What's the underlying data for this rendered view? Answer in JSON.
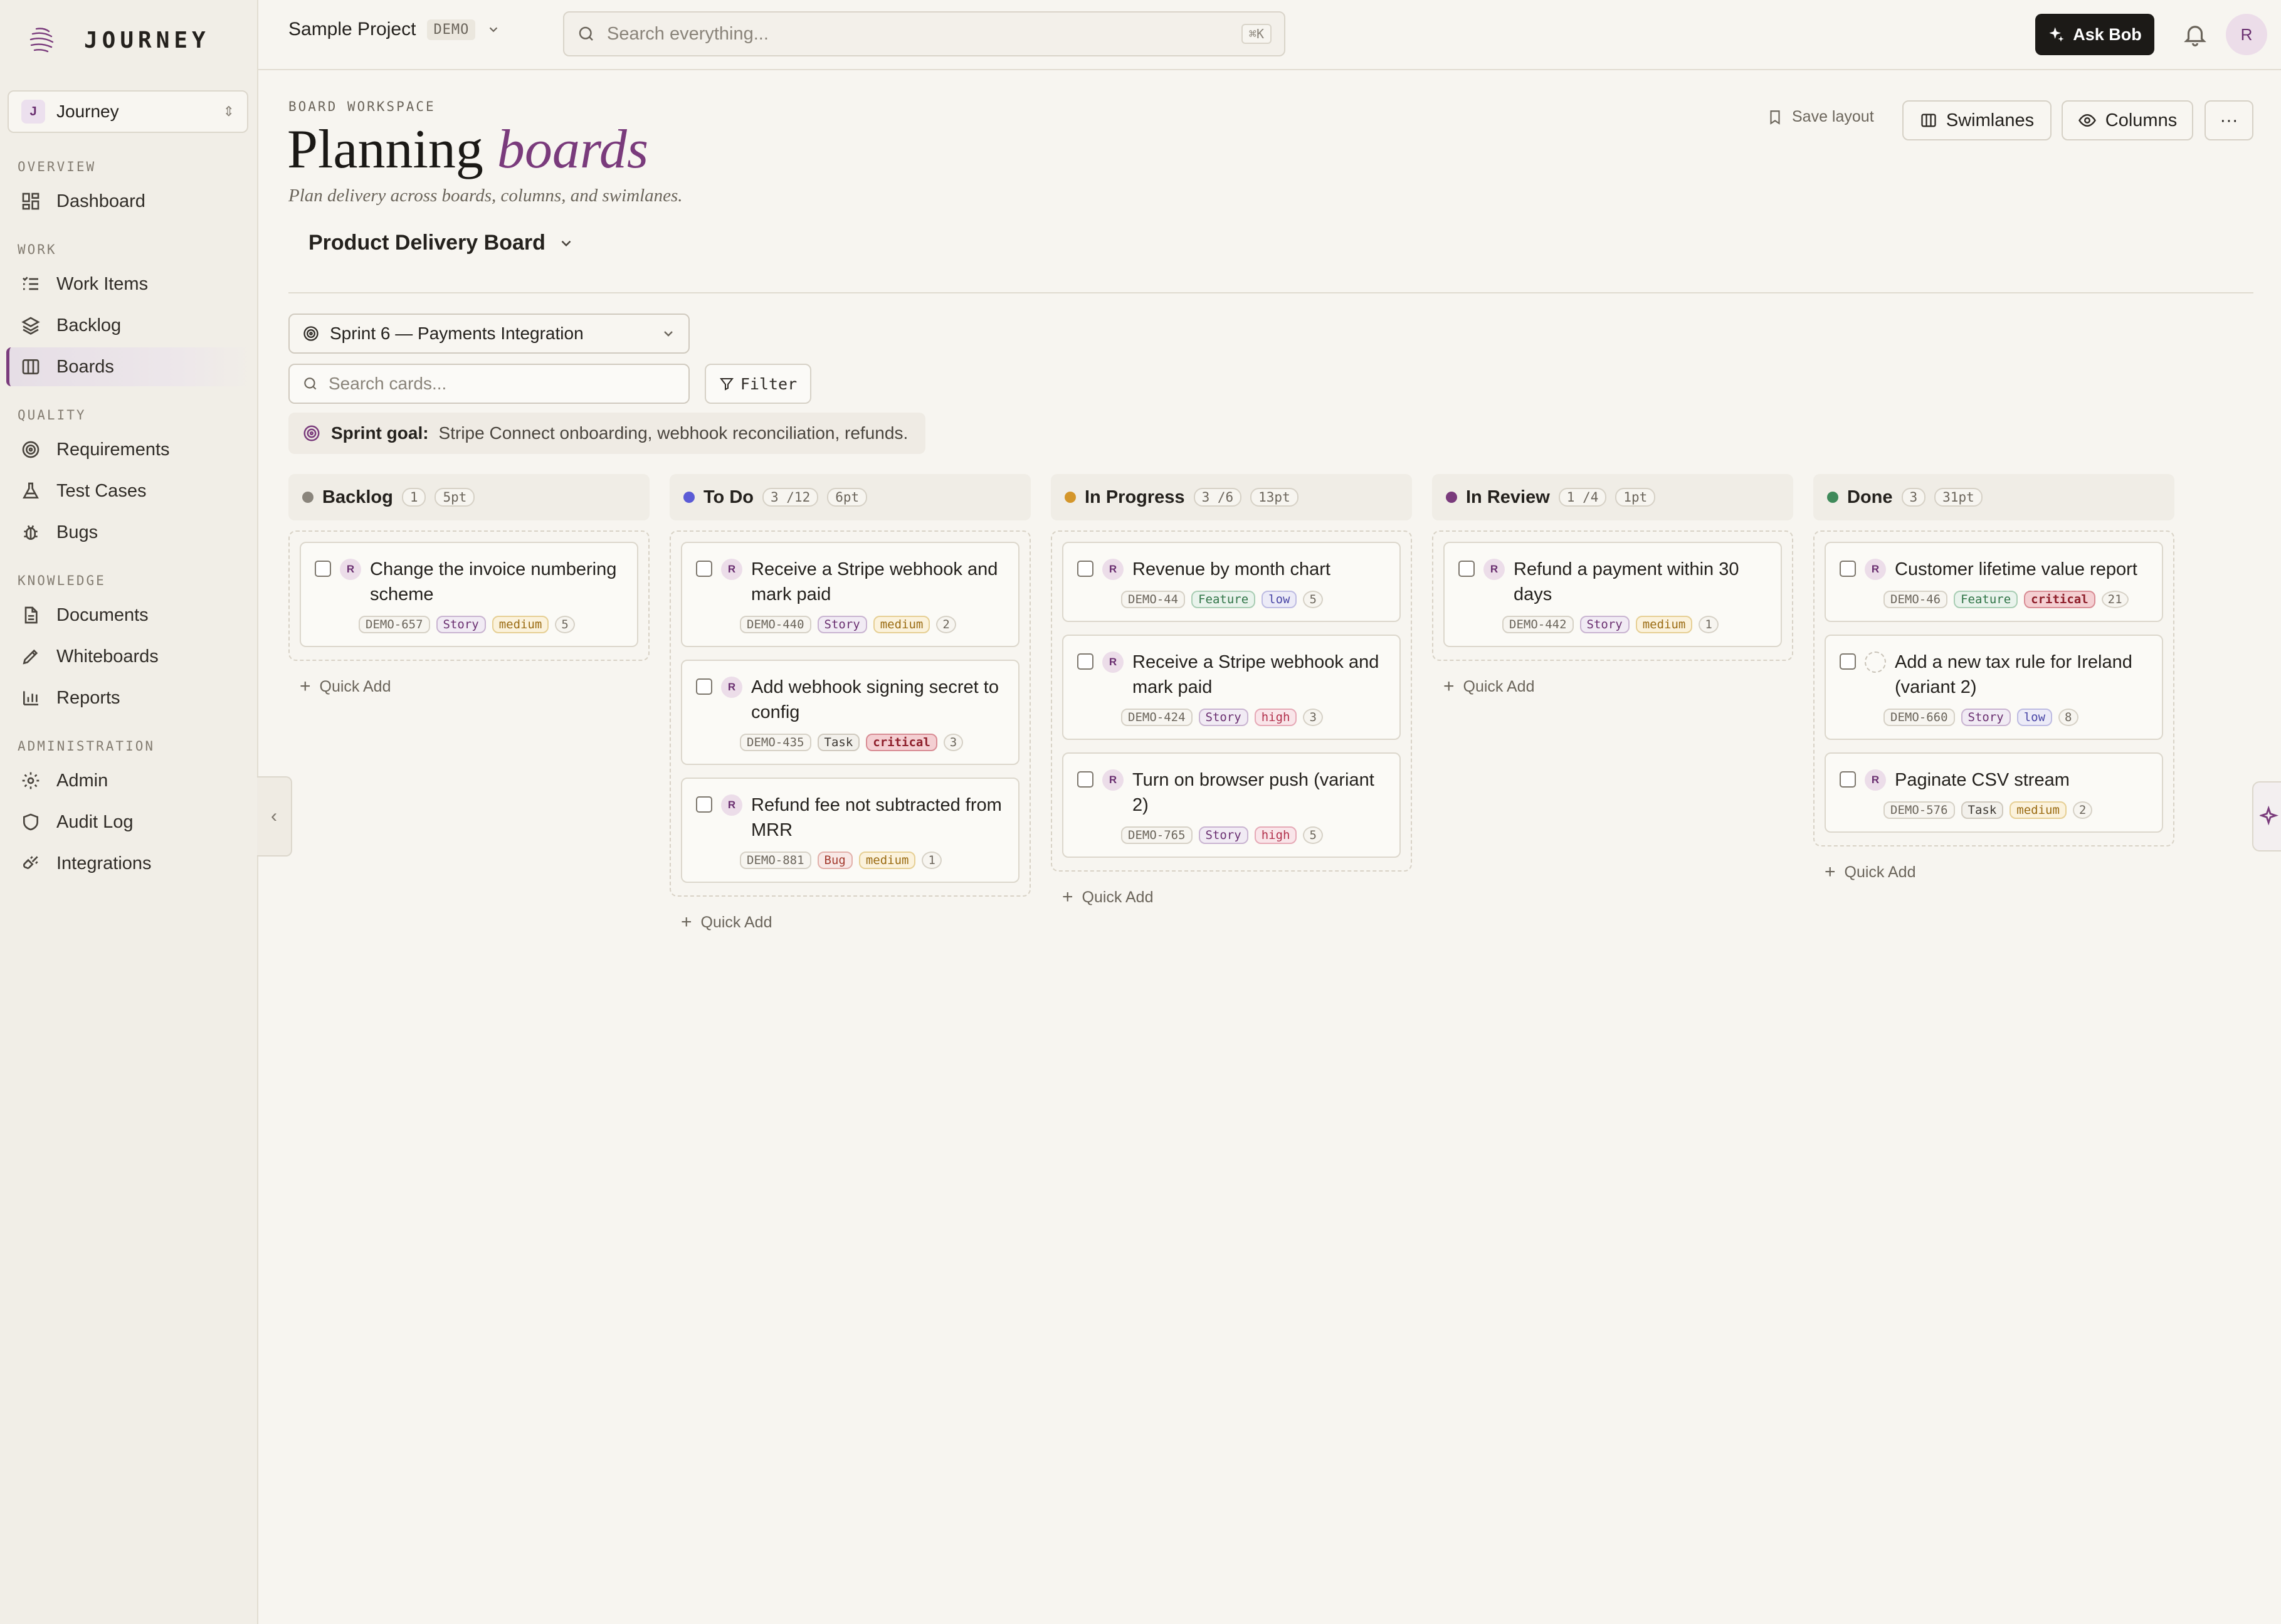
{
  "app": {
    "logo_text": "JOURNEY"
  },
  "workspace": {
    "badge": "J",
    "name": "Journey"
  },
  "sidebar": {
    "sections": [
      {
        "label": "OVERVIEW"
      },
      {
        "label": "WORK"
      },
      {
        "label": "QUALITY"
      },
      {
        "label": "KNOWLEDGE"
      },
      {
        "label": "ADMINISTRATION"
      }
    ],
    "items": [
      {
        "label": "Dashboard",
        "icon": "dashboard-icon"
      },
      {
        "label": "Work Items",
        "icon": "list-icon"
      },
      {
        "label": "Backlog",
        "icon": "layers-icon"
      },
      {
        "label": "Boards",
        "icon": "board-icon",
        "active": true
      },
      {
        "label": "Requirements",
        "icon": "target-icon"
      },
      {
        "label": "Test Cases",
        "icon": "flask-icon"
      },
      {
        "label": "Bugs",
        "icon": "bug-icon"
      },
      {
        "label": "Documents",
        "icon": "document-icon"
      },
      {
        "label": "Whiteboards",
        "icon": "pen-icon"
      },
      {
        "label": "Reports",
        "icon": "bar-chart-icon"
      },
      {
        "label": "Admin",
        "icon": "gear-icon"
      },
      {
        "label": "Audit Log",
        "icon": "shield-icon"
      },
      {
        "label": "Integrations",
        "icon": "plug-icon"
      }
    ]
  },
  "topbar": {
    "project_name": "Sample Project",
    "project_tag": "DEMO",
    "search_placeholder": "Search everything...",
    "search_shortcut": "⌘K",
    "ask_bob_label": "Ask Bob",
    "avatar_initial": "R"
  },
  "header": {
    "eyebrow": "BOARD WORKSPACE",
    "title_main": "Planning",
    "title_accent": "boards",
    "subtitle": "Plan delivery across boards, columns, and swimlanes.",
    "board_name": "Product Delivery Board",
    "save_layout_label": "Save layout",
    "swimlanes_label": "Swimlanes",
    "columns_label": "Columns",
    "more_label": "···"
  },
  "filters": {
    "sprint_label": "Sprint 6 — Payments Integration",
    "search_placeholder": "Search cards...",
    "filter_label": "Filter",
    "goal_label": "Sprint goal:",
    "goal_text": "Stripe Connect onboarding, webhook reconciliation, refunds."
  },
  "colors": {
    "accent": "#7a3b7c",
    "backlog": "#8a857c",
    "todo": "#5b5bd6",
    "in_progress": "#d4962b",
    "in_review": "#7a3b7c",
    "done": "#3f8a5a"
  },
  "board": {
    "quick_add_label": "Quick Add",
    "columns": [
      {
        "title": "Backlog",
        "count": "1",
        "points": "5pt",
        "color": "#8a857c",
        "cards": [
          {
            "title": "Change the invoice numbering scheme",
            "id": "DEMO-657",
            "type": "Story",
            "priority": "medium",
            "points": "5",
            "avatar": "R"
          }
        ]
      },
      {
        "title": "To Do",
        "count": "3 /12",
        "points": "6pt",
        "color": "#5b5bd6",
        "cards": [
          {
            "title": "Receive a Stripe webhook and mark paid",
            "id": "DEMO-440",
            "type": "Story",
            "priority": "medium",
            "points": "2",
            "avatar": "R"
          },
          {
            "title": "Add webhook signing secret to config",
            "id": "DEMO-435",
            "type": "Task",
            "priority": "critical",
            "points": "3",
            "avatar": "R"
          },
          {
            "title": "Refund fee not subtracted from MRR",
            "id": "DEMO-881",
            "type": "Bug",
            "priority": "medium",
            "points": "1",
            "avatar": "R"
          }
        ]
      },
      {
        "title": "In Progress",
        "count": "3 /6",
        "points": "13pt",
        "color": "#d4962b",
        "cards": [
          {
            "title": "Revenue by month chart",
            "id": "DEMO-44",
            "type": "Feature",
            "priority": "low",
            "points": "5",
            "avatar": "R"
          },
          {
            "title": "Receive a Stripe webhook and mark paid",
            "id": "DEMO-424",
            "type": "Story",
            "priority": "high",
            "points": "3",
            "avatar": "R"
          },
          {
            "title": "Turn on browser push (variant 2)",
            "id": "DEMO-765",
            "type": "Story",
            "priority": "high",
            "points": "5",
            "avatar": "R"
          }
        ]
      },
      {
        "title": "In Review",
        "count": "1 /4",
        "points": "1pt",
        "color": "#7a3b7c",
        "cards": [
          {
            "title": "Refund a payment within 30 days",
            "id": "DEMO-442",
            "type": "Story",
            "priority": "medium",
            "points": "1",
            "avatar": "R"
          }
        ]
      },
      {
        "title": "Done",
        "count": "3",
        "points": "31pt",
        "color": "#3f8a5a",
        "cards": [
          {
            "title": "Customer lifetime value report",
            "id": "DEMO-46",
            "type": "Feature",
            "priority": "critical",
            "points": "21",
            "avatar": "R"
          },
          {
            "title": "Add a new tax rule for Ireland (variant 2)",
            "id": "DEMO-660",
            "type": "Story",
            "priority": "low",
            "points": "8",
            "avatar": ""
          },
          {
            "title": "Paginate CSV stream",
            "id": "DEMO-576",
            "type": "Task",
            "priority": "medium",
            "points": "2",
            "avatar": "R"
          }
        ]
      }
    ]
  }
}
